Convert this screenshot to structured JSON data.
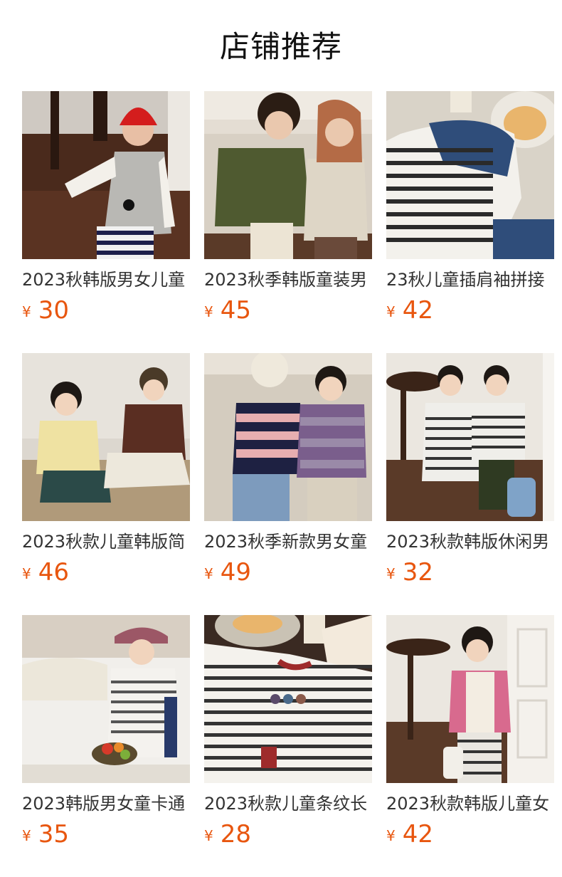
{
  "header": {
    "title": "店铺推荐"
  },
  "currency_symbol": "¥",
  "products": [
    {
      "name": "2023秋韩版男女儿童",
      "price": "30",
      "image": "boy-red-beanie-grey-vest-photo"
    },
    {
      "name": "2023秋季韩版童装男",
      "price": "45",
      "image": "two-kids-knit-cardigans-photo"
    },
    {
      "name": "23秋儿童插肩袖拼接",
      "price": "42",
      "image": "striped-raglan-sweater-flatlay-photo"
    },
    {
      "name": "2023秋款儿童韩版简",
      "price": "46",
      "image": "two-kids-sitting-cardigans-photo"
    },
    {
      "name": "2023秋季新款男女童",
      "price": "49",
      "image": "two-kids-striped-sweaters-photo"
    },
    {
      "name": "2023秋款韩版休闲男",
      "price": "32",
      "image": "two-kids-mouse-sweatshirts-photo"
    },
    {
      "name": "2023韩版男女童卡通",
      "price": "35",
      "image": "boy-cap-fruit-basket-photo"
    },
    {
      "name": "2023秋款儿童条纹长",
      "price": "28",
      "image": "striped-tee-flatlay-photo"
    },
    {
      "name": "2023秋款韩版儿童女",
      "price": "42",
      "image": "girl-pink-cardigan-photo"
    }
  ]
}
